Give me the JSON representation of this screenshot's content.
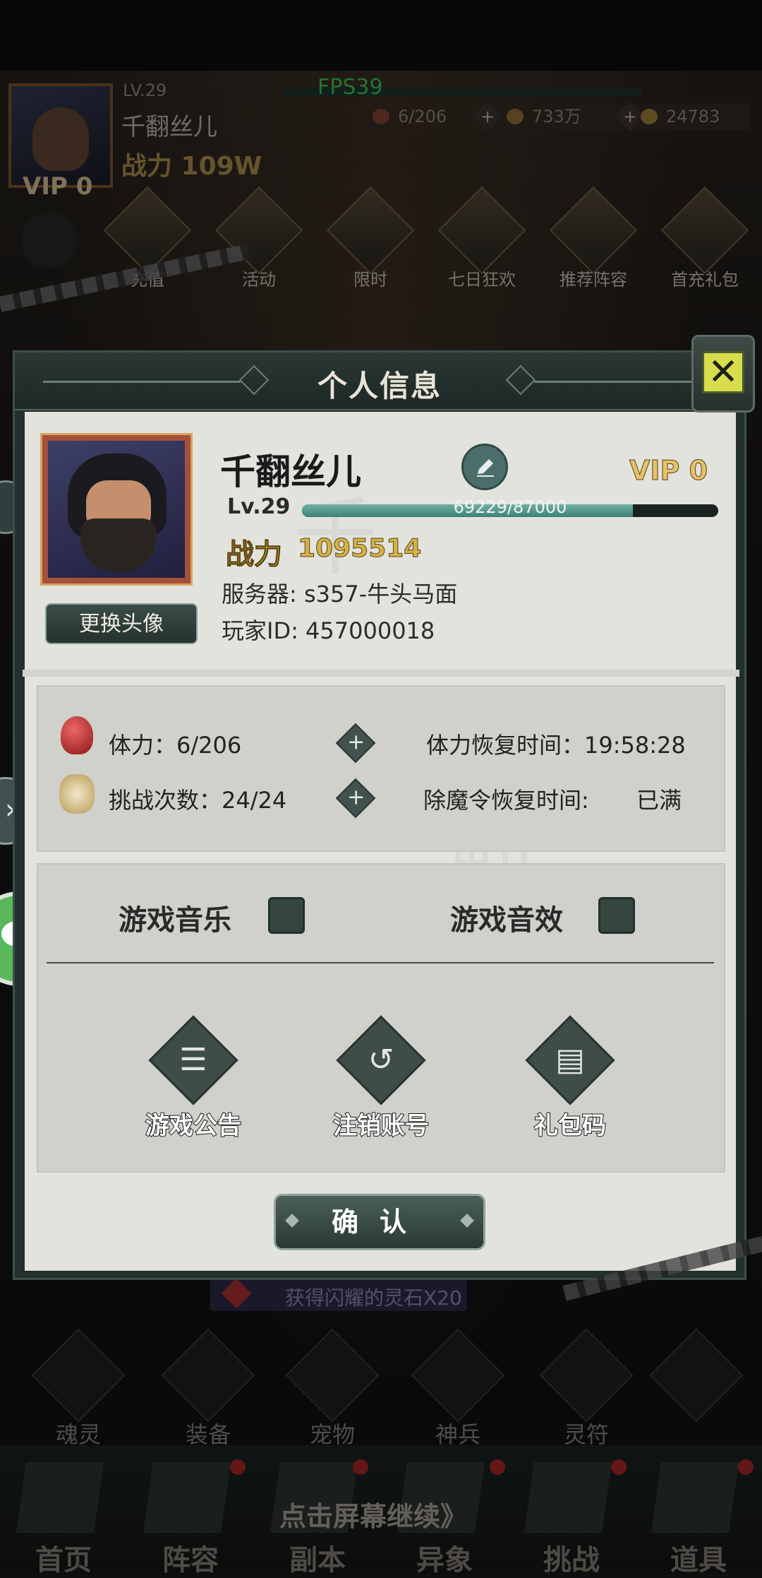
{
  "hud": {
    "level": "LV.29",
    "fps": "FPS39",
    "name": "千翻丝儿",
    "power": "战力 109W",
    "vip": "VIP 0",
    "stamina": "6/206",
    "coins": "733万",
    "gems": "24783",
    "menu_row": [
      "充值",
      "活动",
      "限时",
      "七日狂欢",
      "推荐阵容",
      "首充礼包"
    ]
  },
  "notice": "获得闪耀的灵石X20",
  "bottom_icons": [
    "魂灵",
    "装备",
    "宠物",
    "神兵",
    "灵符"
  ],
  "bottom_nav": [
    "首页",
    "阵容",
    "副本",
    "异象",
    "挑战",
    "道具"
  ],
  "tap_continue": "点击屏幕继续》",
  "modal": {
    "title": "个人信息",
    "name": "千翻丝儿",
    "vip": "VIP 0",
    "level": "Lv.29",
    "exp_text": "69229/87000",
    "exp_fraction": 0.7957,
    "power_label": "战力",
    "power_value": "1095514",
    "server": "服务器: s357-牛头马面",
    "player_id": "玩家ID: 457000018",
    "change_avatar": "更换头像",
    "stamina": "体力：6/206",
    "stamina_recover": "体力恢复时间：19:58:28",
    "challenges": "挑战次数：24/24",
    "demon_recover_label": "除魔令恢复时间:",
    "demon_recover_value": "已满",
    "music_label": "游戏音乐",
    "sfx_label": "游戏音效",
    "func_buttons": [
      "游戏公告",
      "注销账号",
      "礼包码"
    ],
    "confirm": "确认"
  }
}
